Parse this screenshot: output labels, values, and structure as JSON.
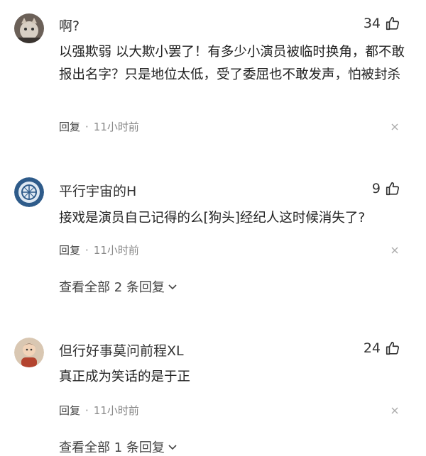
{
  "comments": [
    {
      "username": "啊?",
      "likes": "34",
      "text": "以强欺弱 以大欺小罢了！有多少小演员被临时换角，都不敢报出名字？只是地位太低，受了委屈也不敢发声，怕被封杀",
      "reply_label": "回复",
      "separator": "·",
      "time": "11小时前"
    },
    {
      "username": "平行宇宙的H",
      "likes": "9",
      "text": "接戏是演员自己记得的么[狗头]经纪人这时候消失了?",
      "reply_label": "回复",
      "separator": "·",
      "time": "11小时前",
      "view_all": "查看全部 2 条回复"
    },
    {
      "username": "但行好事莫问前程XL",
      "likes": "24",
      "text": "真正成为笑话的是于正",
      "reply_label": "回复",
      "separator": "·",
      "time": "11小时前",
      "view_all": "查看全部 1 条回复"
    }
  ],
  "icons": {
    "like": "thumbs-up-icon",
    "close": "close-icon",
    "expand": "chevron-down-icon"
  },
  "colors": {
    "text": "#222222",
    "meta": "#888888",
    "background": "#ffffff"
  }
}
